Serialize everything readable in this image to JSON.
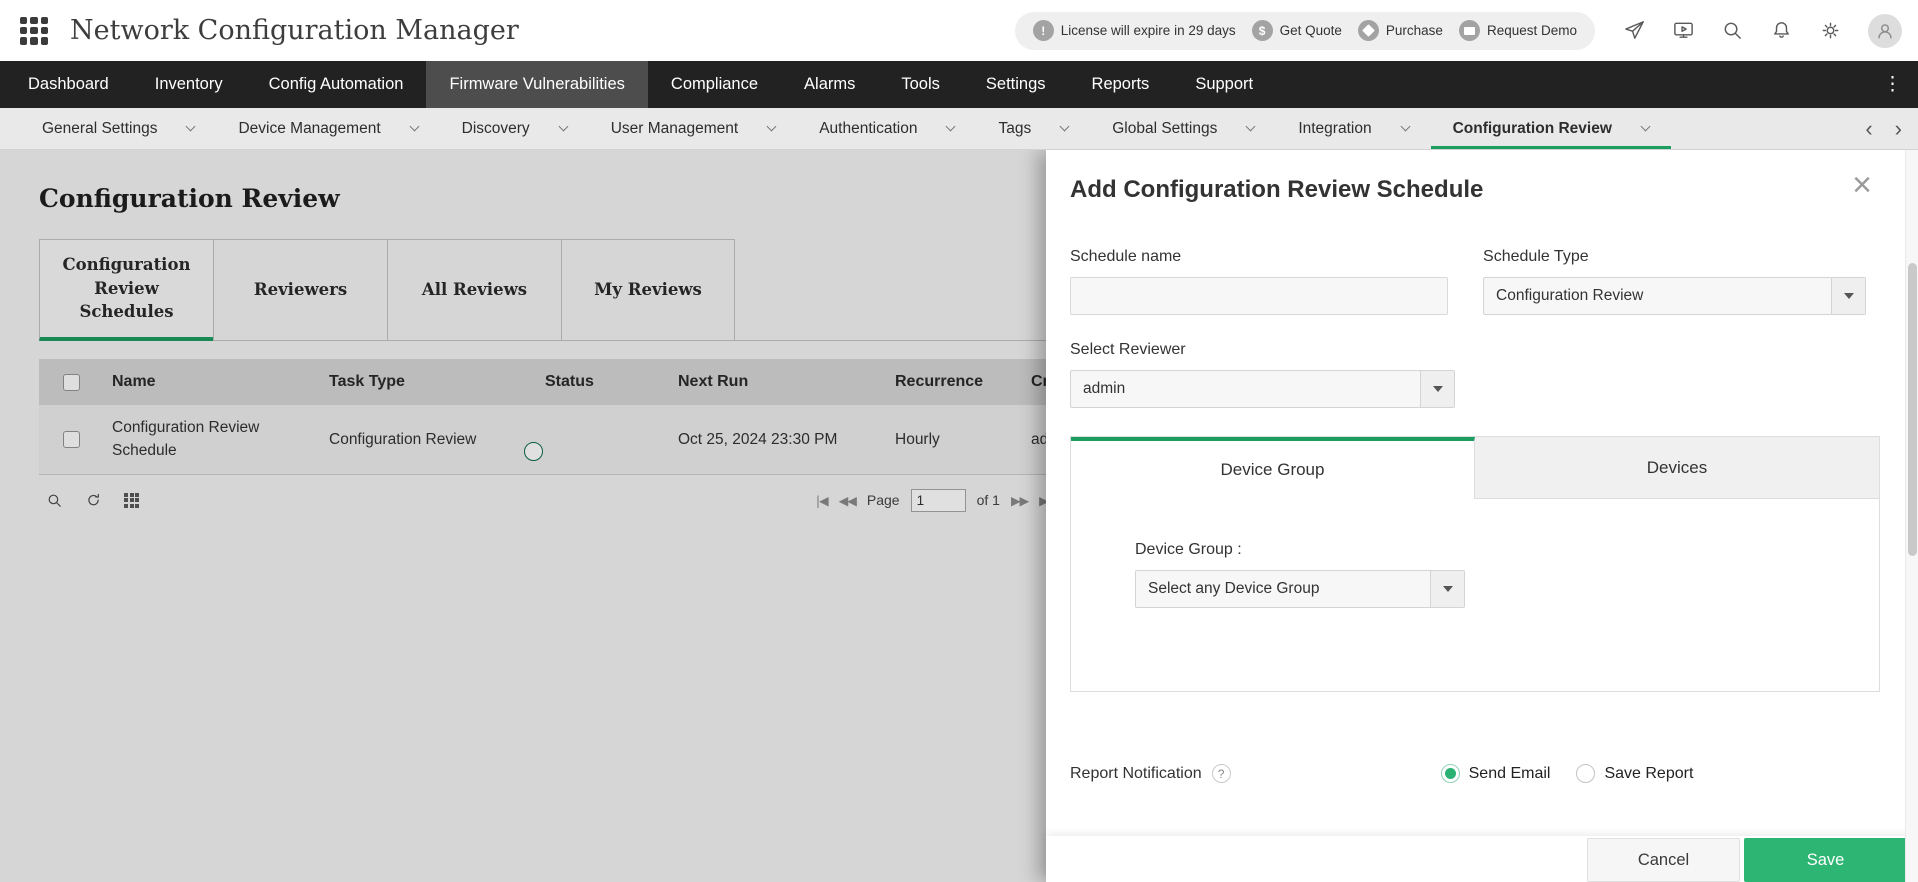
{
  "header": {
    "app_title": "Network Configuration Manager",
    "badges": {
      "license": "License will expire in 29 days",
      "get_quote": "Get Quote",
      "purchase": "Purchase",
      "request_demo": "Request Demo"
    }
  },
  "nav": {
    "items": [
      "Dashboard",
      "Inventory",
      "Config Automation",
      "Firmware Vulnerabilities",
      "Compliance",
      "Alarms",
      "Tools",
      "Settings",
      "Reports",
      "Support"
    ],
    "active": "Firmware Vulnerabilities"
  },
  "subnav": {
    "items": [
      "General Settings",
      "Device Management",
      "Discovery",
      "User Management",
      "Authentication",
      "Tags",
      "Global Settings",
      "Integration",
      "Configuration Review"
    ],
    "active": "Configuration Review"
  },
  "page": {
    "title": "Configuration Review",
    "tabs": [
      "Configuration Review Schedules",
      "Reviewers",
      "All Reviews",
      "My Reviews"
    ],
    "active_tab": "Configuration Review Schedules"
  },
  "table": {
    "headers": [
      "Name",
      "Task Type",
      "Status",
      "Next Run",
      "Recurrence",
      "Cre"
    ],
    "row": {
      "name": "Configuration Review Schedule",
      "task_type": "Configuration Review",
      "status_on": true,
      "next_run": "Oct 25, 2024 23:30 PM",
      "recurrence": "Hourly",
      "created_by": "ad"
    },
    "pagination": {
      "page_label": "Page",
      "page_value": "1",
      "of_label": "of 1"
    }
  },
  "panel": {
    "title": "Add Configuration Review Schedule",
    "fields": {
      "schedule_name_label": "Schedule name",
      "schedule_type_label": "Schedule Type",
      "schedule_type_value": "Configuration Review",
      "select_reviewer_label": "Select Reviewer",
      "select_reviewer_value": "admin",
      "device_group_tab": "Device Group",
      "devices_tab": "Devices",
      "device_group_label": "Device Group :",
      "device_group_value": "Select any Device Group",
      "report_notification_label": "Report Notification",
      "send_email": "Send Email",
      "save_report": "Save Report"
    },
    "buttons": {
      "cancel": "Cancel",
      "save": "Save"
    }
  },
  "icons": {
    "first_page": "|◀",
    "prev_page": "◀◀",
    "next_page": "▶▶",
    "last_page": "▶|",
    "kebab": "⋮",
    "scroll_left": "‹",
    "scroll_right": "›",
    "close": "×",
    "help": "?"
  },
  "colors": {
    "accent_green": "#1d9e61",
    "save_green": "#2db573",
    "nav_dark": "#222222"
  }
}
